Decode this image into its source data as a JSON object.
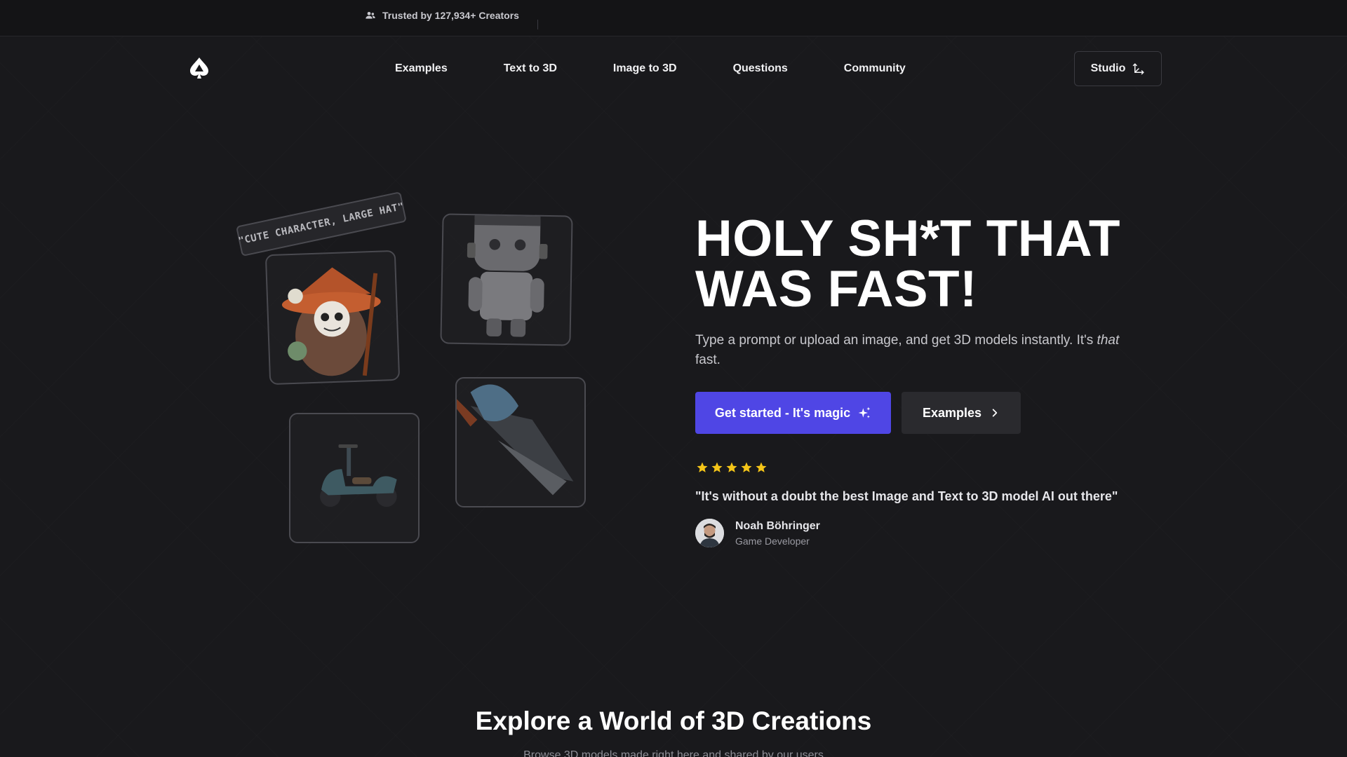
{
  "topbar": {
    "trusted_text": "Trusted by 127,934+ Creators",
    "icon": "users-icon"
  },
  "nav": {
    "logo_icon": "spade-logo-icon",
    "links": [
      {
        "label": "Examples"
      },
      {
        "label": "Text to 3D"
      },
      {
        "label": "Image to 3D"
      },
      {
        "label": "Questions"
      },
      {
        "label": "Community"
      }
    ],
    "studio_label": "Studio",
    "studio_icon": "axis-3d-icon"
  },
  "hero": {
    "prompt_tag": "\"CUTE CHARACTER, LARGE HAT\"",
    "headline": "HOLY SH*T THAT WAS FAST!",
    "subtext_before": "Type a prompt or upload an image, and get 3D models instantly. It's ",
    "subtext_em": "that",
    "subtext_after": " fast.",
    "cta_primary": "Get started - It's magic",
    "cta_primary_icon": "sparkles-icon",
    "cta_secondary": "Examples",
    "cta_secondary_icon": "chevron-right-icon",
    "rating_stars": 5,
    "star_color": "#f5c518",
    "quote": "\"It's without a doubt the best Image and Text to 3D model AI out there\"",
    "reviewer_name": "Noah Böhringer",
    "reviewer_role": "Game Developer"
  },
  "explore": {
    "title": "Explore a World of 3D Creations",
    "subtitle": "Browse 3D models made right here and shared by our users"
  },
  "colors": {
    "background": "#19191c",
    "accent": "#4f46e5",
    "secondary_button": "#2a2a2e"
  }
}
